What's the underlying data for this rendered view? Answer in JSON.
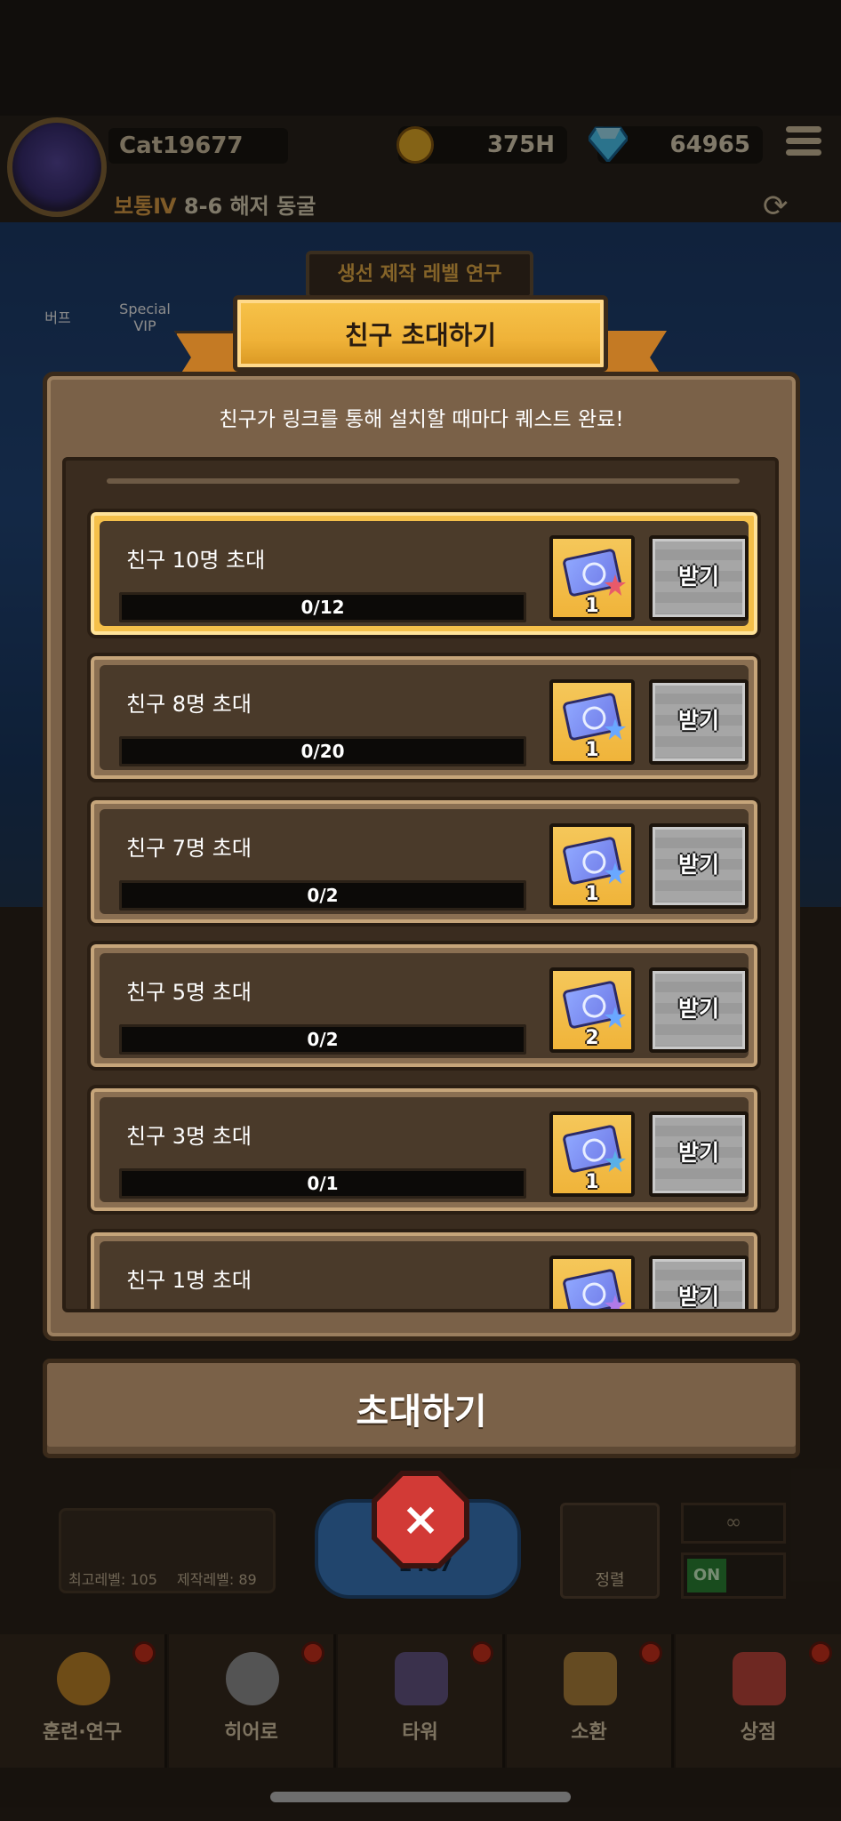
{
  "header": {
    "player_name": "Cat19677",
    "gold": "375H",
    "gems": "64965",
    "stage_difficulty": "보통Ⅳ",
    "stage_name": "8-6 해저 동굴"
  },
  "background": {
    "research_button": "생선 제작 레벨 연구",
    "buff_label": "버프",
    "vip_label": "Special VIP",
    "stat_max_level": "최고레벨: 105",
    "stat_craft_level": "제작레벨: 89",
    "fish_value": "1487",
    "sort_label": "정렬",
    "infinite": "∞",
    "toggle_on": "ON"
  },
  "modal": {
    "title": "친구 초대하기",
    "subtitle": "친구가 링크를 통해 설치할 때마다 퀘스트 완료!",
    "quests": [
      {
        "title": "친구 10명 초대",
        "progress": "0/12",
        "reward_count": "1",
        "claim_label": "받기",
        "star_color": "#e85a6a"
      },
      {
        "title": "친구 8명 초대",
        "progress": "0/20",
        "reward_count": "1",
        "claim_label": "받기",
        "star_color": "#6aa8ff"
      },
      {
        "title": "친구 7명 초대",
        "progress": "0/2",
        "reward_count": "1",
        "claim_label": "받기",
        "star_color": "#6aa8ff"
      },
      {
        "title": "친구 5명 초대",
        "progress": "0/2",
        "reward_count": "2",
        "claim_label": "받기",
        "star_color": "#6aa8ff"
      },
      {
        "title": "친구 3명 초대",
        "progress": "0/1",
        "reward_count": "1",
        "claim_label": "받기",
        "star_color": "#5ab0e8"
      },
      {
        "title": "친구 1명 초대",
        "progress": "",
        "reward_count": "",
        "claim_label": "받기",
        "star_color": "#b07ae8"
      }
    ],
    "invite_button": "초대하기",
    "close_icon": "×"
  },
  "bottom_nav": [
    {
      "label": "훈련·연구",
      "icon": "paw-icon"
    },
    {
      "label": "히어로",
      "icon": "hero-cat-icon"
    },
    {
      "label": "타워",
      "icon": "tower-icon"
    },
    {
      "label": "소환",
      "icon": "summon-box-icon"
    },
    {
      "label": "상점",
      "icon": "shop-icon"
    }
  ],
  "colors": {
    "ribbon_gold": "#f0b43a",
    "modal_brown": "#7a6148",
    "close_red": "#d23a36"
  }
}
